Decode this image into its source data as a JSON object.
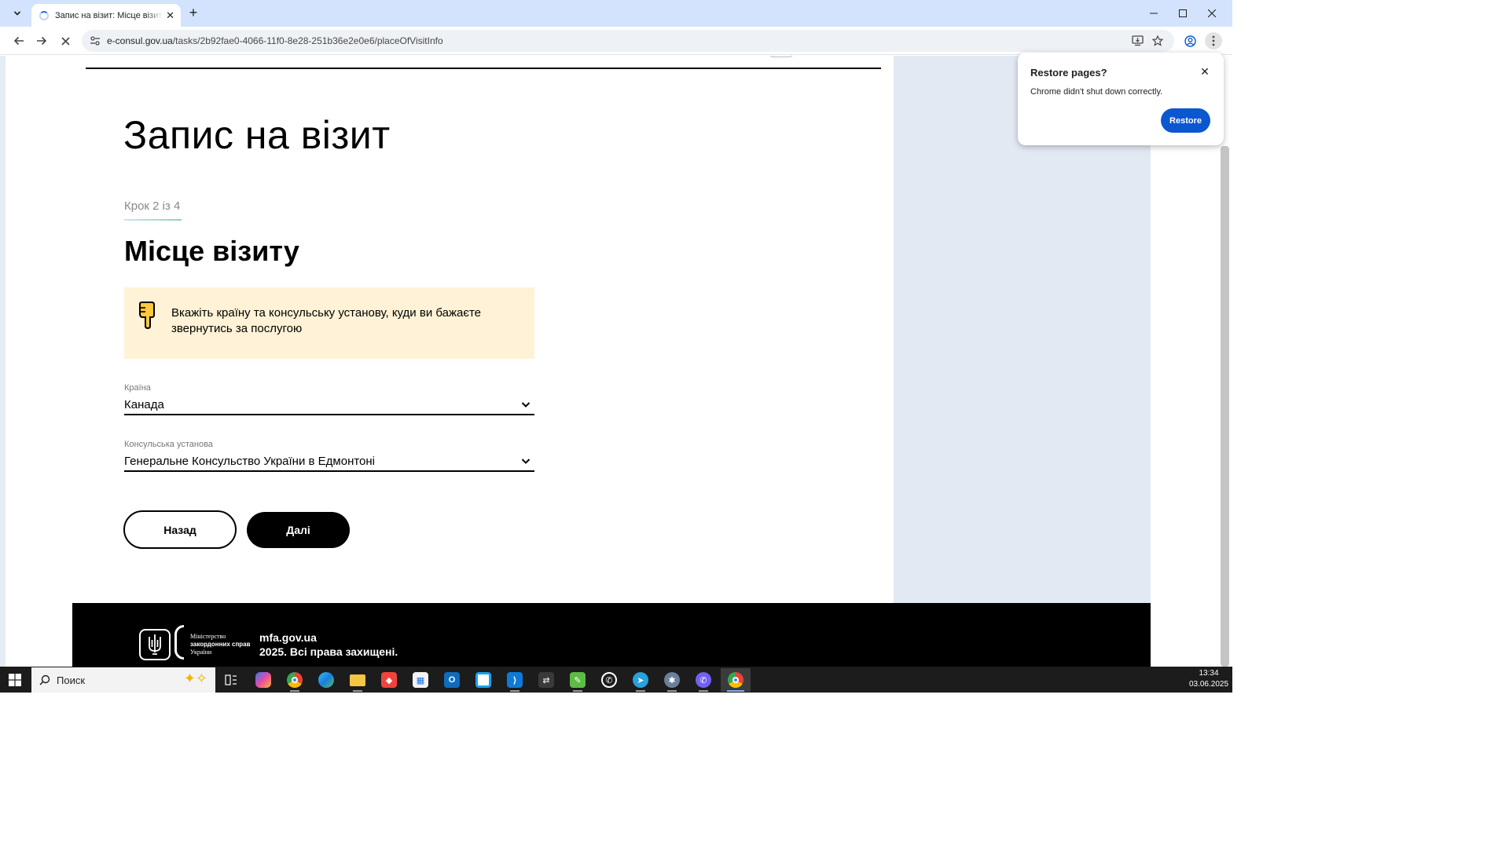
{
  "browser": {
    "tab_title": "Запис на візит: Місце візиту - e-Консул",
    "url_host": "e-consul.gov.ua",
    "url_path": "/tasks/2b92fae0-4066-11f0-8e28-251b36e2e0e6/placeOfVisitInfo"
  },
  "page": {
    "title": "Запис на візит",
    "step": "Крок 2 із 4",
    "section_title": "Місце візиту",
    "info_text": "Вкажіть країну та консульську установу, куди ви бажаєте звернутись за послугою",
    "country": {
      "label": "Країна",
      "value": "Канада"
    },
    "consulate": {
      "label": "Консульська установа",
      "value": "Генеральне Консульство України в Едмонтоні"
    },
    "back_label": "Назад",
    "next_label": "Далі"
  },
  "footer": {
    "ministry_line1": "Міністерство",
    "ministry_line2": "закордонних справ",
    "ministry_line3": "України",
    "site": "mfa.gov.ua",
    "rights": "2025. Всі права захищені."
  },
  "restore_popup": {
    "title": "Restore pages?",
    "message": "Chrome didn't shut down correctly.",
    "button": "Restore"
  },
  "taskbar": {
    "search_placeholder": "Поиск",
    "time": "13:34",
    "date": "03.06.2025",
    "apps": [
      "task-view",
      "copilot",
      "chrome-profile",
      "edge",
      "file-explorer",
      "anydesk",
      "microsoft-store",
      "outlook",
      "snipping-tool",
      "vscode",
      "remote-desktop",
      "notepad",
      "whatsapp",
      "telegram",
      "pinned-app",
      "viber",
      "chrome"
    ]
  },
  "colors": {
    "info_background": "#fff2d6",
    "footer_background": "#000000",
    "primary_button": "#000000",
    "restore_button": "#0b57d0",
    "tabbar": "#d3e3fd",
    "side_panel": "#e2e9f3"
  }
}
